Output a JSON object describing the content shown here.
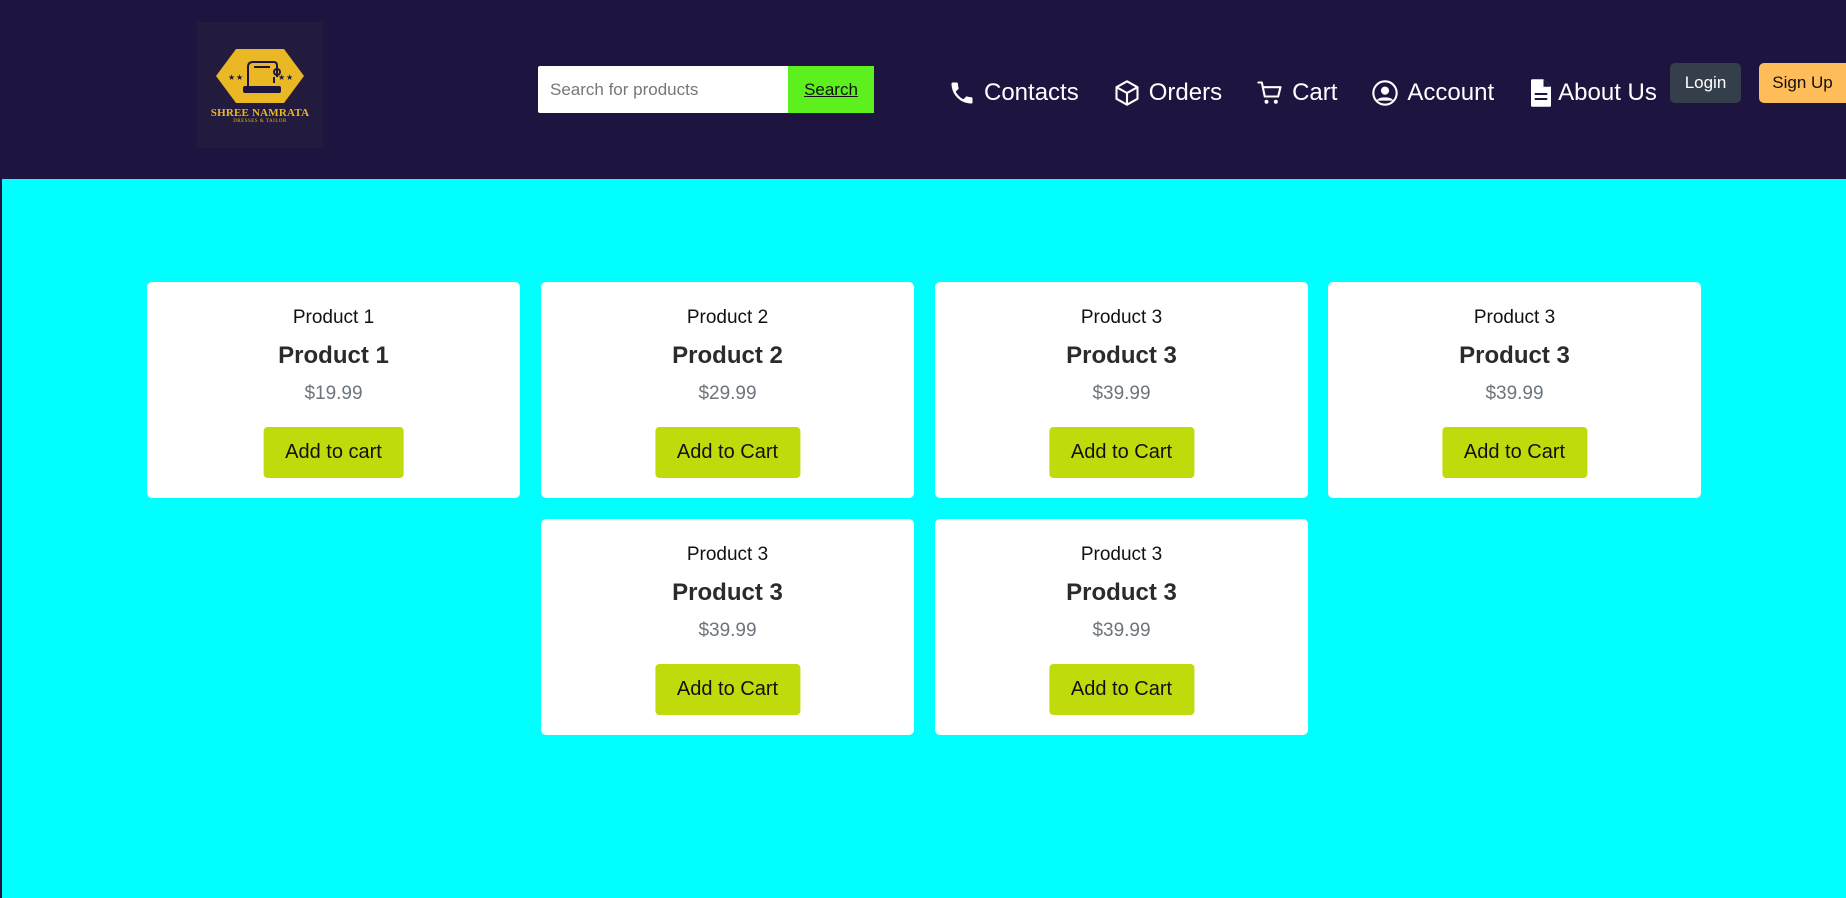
{
  "brand": {
    "name": "SHREE NAMRATA",
    "tagline": "DRESSES & TAILOR",
    "color": "#e9b824"
  },
  "search": {
    "placeholder": "Search for products",
    "button_label": "Search"
  },
  "nav": {
    "items": [
      {
        "label": "Contacts",
        "icon": "phone-icon"
      },
      {
        "label": "Orders",
        "icon": "box-icon"
      },
      {
        "label": "Cart",
        "icon": "cart-icon"
      },
      {
        "label": "Account",
        "icon": "user-circle-icon"
      },
      {
        "label": "About Us",
        "icon": "document-icon"
      }
    ]
  },
  "auth": {
    "login_label": "Login",
    "signup_label": "Sign Up"
  },
  "products": [
    {
      "label": "Product 1",
      "title": "Product 1",
      "price": "$19.99",
      "button": "Add to cart"
    },
    {
      "label": "Product 2",
      "title": "Product 2",
      "price": "$29.99",
      "button": "Add to Cart"
    },
    {
      "label": "Product 3",
      "title": "Product 3",
      "price": "$39.99",
      "button": "Add to Cart"
    },
    {
      "label": "Product 3",
      "title": "Product 3",
      "price": "$39.99",
      "button": "Add to Cart"
    },
    {
      "label": "Product 3",
      "title": "Product 3",
      "price": "$39.99",
      "button": "Add to Cart"
    },
    {
      "label": "Product 3",
      "title": "Product 3",
      "price": "$39.99",
      "button": "Add to Cart"
    }
  ],
  "colors": {
    "header_bg": "#1e1440",
    "page_bg": "#00ffff",
    "search_button": "#5ef01e",
    "add_to_cart": "#bfdb0b",
    "login_button": "#343f4b",
    "signup_button": "#ffbd59"
  }
}
